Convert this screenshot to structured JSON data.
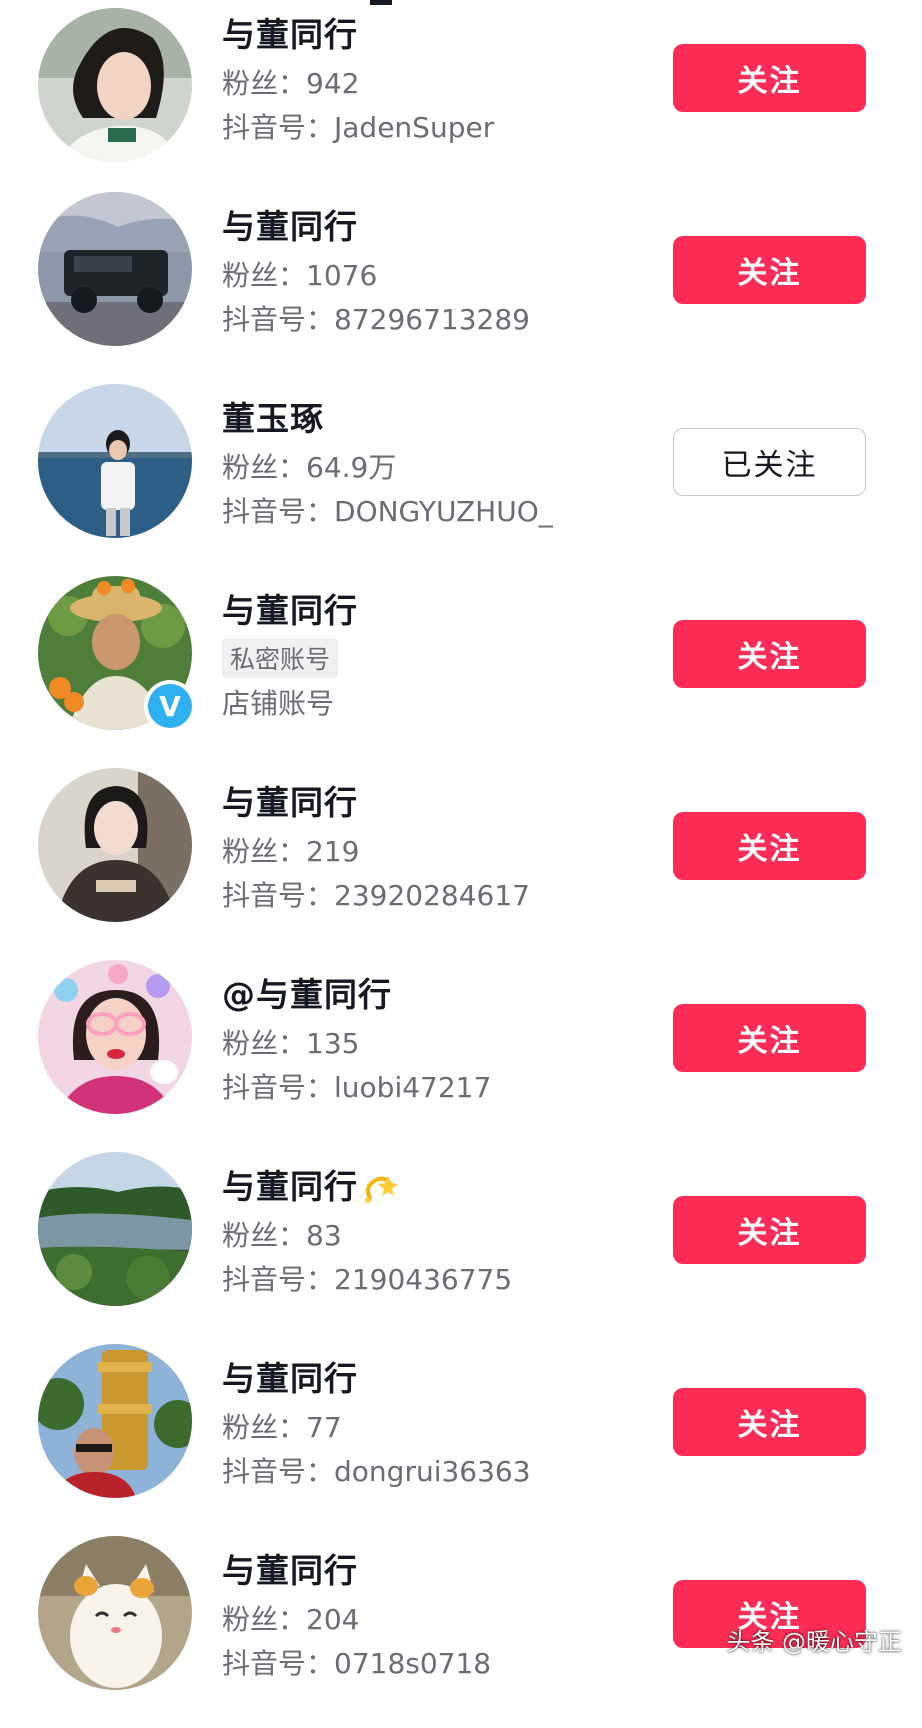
{
  "users": [
    {
      "name": "与董同行",
      "fans_label": "粉丝：",
      "fans": "942",
      "id_label": "抖音号：",
      "id": "JadenSuper",
      "button": "关注",
      "followed": false,
      "avatar": "woman-portrait"
    },
    {
      "name": "与董同行",
      "fans_label": "粉丝：",
      "fans": "1076",
      "id_label": "抖音号：",
      "id": "87296713289",
      "button": "关注",
      "followed": false,
      "avatar": "black-suv"
    },
    {
      "name": "董玉琢",
      "fans_label": "粉丝：",
      "fans": "64.9万",
      "id_label": "抖音号：",
      "id": "DONGYUZHUO_",
      "button": "已关注",
      "followed": true,
      "avatar": "person-by-sea"
    },
    {
      "name": "与董同行",
      "tag": "私密账号",
      "line3": "店铺账号",
      "button": "关注",
      "followed": false,
      "avatar": "man-with-oranges",
      "verified_badge": "V"
    },
    {
      "name": "与董同行",
      "fans_label": "粉丝：",
      "fans": "219",
      "id_label": "抖音号：",
      "id": "23920284617",
      "button": "关注",
      "followed": false,
      "avatar": "girl-hoodie"
    },
    {
      "name": "@与董同行",
      "fans_label": "粉丝：",
      "fans": "135",
      "id_label": "抖音号：",
      "id": "luobi47217",
      "button": "关注",
      "followed": false,
      "avatar": "woman-filter"
    },
    {
      "name": "与董同行",
      "fans_label": "粉丝：",
      "fans": "83",
      "id_label": "抖音号：",
      "id": "2190436775",
      "button": "关注",
      "followed": false,
      "avatar": "lake-landscape",
      "name_icon": "sparkle-icon"
    },
    {
      "name": "与董同行",
      "fans_label": "粉丝：",
      "fans": "77",
      "id_label": "抖音号：",
      "id": "dongrui36363",
      "button": "关注",
      "followed": false,
      "avatar": "man-golden-tower"
    },
    {
      "name": "与董同行",
      "fans_label": "粉丝：",
      "fans": "204",
      "id_label": "抖音号：",
      "id": "0718s0718",
      "button": "关注",
      "followed": false,
      "avatar": "lucky-cat"
    }
  ],
  "watermark": "头条 @暖心守正",
  "colors": {
    "accent": "#fe2c55",
    "text": "#161823",
    "secondary": "#6b6d74"
  }
}
